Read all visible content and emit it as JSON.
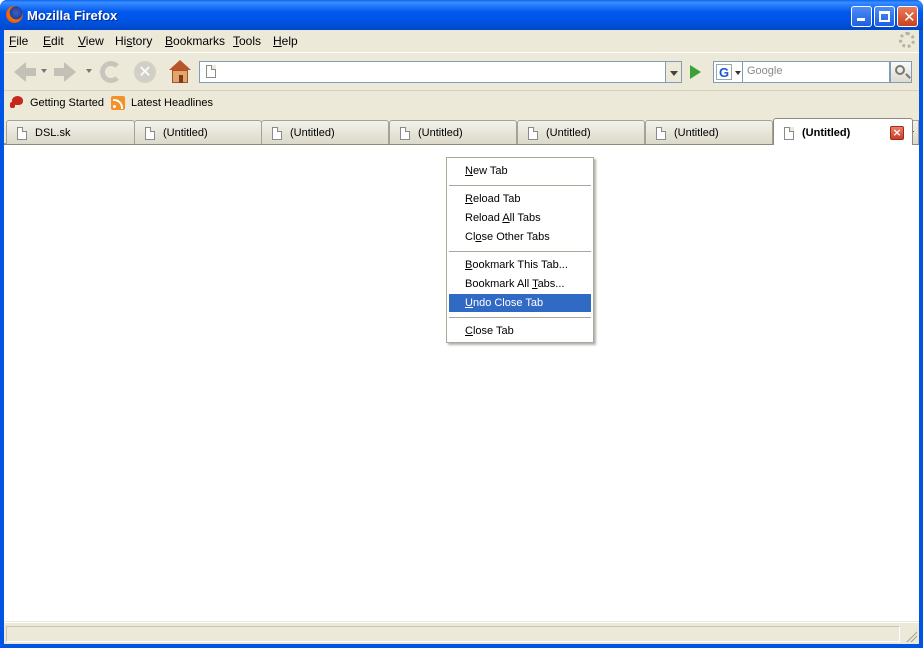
{
  "window": {
    "title": "Mozilla Firefox",
    "colors": {
      "titlebar": "#0054e3",
      "chrome": "#ece9d8",
      "menu_highlight": "#316ac5"
    }
  },
  "menubar": {
    "items": [
      {
        "label": "File",
        "accel": "F",
        "rest": "ile"
      },
      {
        "label": "Edit",
        "accel": "E",
        "rest": "dit"
      },
      {
        "label": "View",
        "accel": "V",
        "rest": "iew"
      },
      {
        "label": "History",
        "accel": "s",
        "pre": "Hi",
        "rest": "tory"
      },
      {
        "label": "Bookmarks",
        "accel": "B",
        "rest": "ookmarks"
      },
      {
        "label": "Tools",
        "accel": "T",
        "rest": "ools"
      },
      {
        "label": "Help",
        "accel": "H",
        "rest": "elp"
      }
    ]
  },
  "navbar": {
    "url_value": "",
    "search_placeholder": "Google",
    "search_engine_letter": "G",
    "stop_glyph": "✕",
    "icons": [
      "back-arrow-icon",
      "forward-arrow-icon",
      "reload-icon",
      "stop-icon",
      "home-icon",
      "go-arrow-icon",
      "magnifier-icon"
    ]
  },
  "bookmarks": {
    "items": [
      {
        "label": "Getting Started",
        "icon": "getting-started-icon"
      },
      {
        "label": "Latest Headlines",
        "icon": "rss-feed-icon"
      }
    ]
  },
  "tabs": [
    {
      "label": "DSL.sk",
      "active": false
    },
    {
      "label": "(Untitled)",
      "active": false
    },
    {
      "label": "(Untitled)",
      "active": false
    },
    {
      "label": "(Untitled)",
      "active": false
    },
    {
      "label": "(Untitled)",
      "active": false
    },
    {
      "label": "(Untitled)",
      "active": false
    },
    {
      "label": "(Untitled)",
      "active": true
    }
  ],
  "tab_close_glyph": "×",
  "context_menu": {
    "items": [
      {
        "label": "New Tab",
        "accel": "N",
        "rest": "ew Tab",
        "highlighted": false
      },
      {
        "separator": true
      },
      {
        "label": "Reload Tab",
        "accel": "R",
        "rest": "eload Tab",
        "highlighted": false
      },
      {
        "label": "Reload All Tabs",
        "pre": "Reload ",
        "accel": "A",
        "rest": "ll Tabs",
        "highlighted": false
      },
      {
        "label": "Close Other Tabs",
        "pre": "Cl",
        "accel": "o",
        "rest": "se Other Tabs",
        "highlighted": false
      },
      {
        "separator": true
      },
      {
        "label": "Bookmark This Tab...",
        "accel": "B",
        "rest": "ookmark This Tab...",
        "highlighted": false
      },
      {
        "label": "Bookmark All Tabs...",
        "pre": "Bookmark All ",
        "accel": "T",
        "rest": "abs...",
        "highlighted": false
      },
      {
        "label": "Undo Close Tab",
        "accel": "U",
        "rest": "ndo Close Tab",
        "highlighted": true
      },
      {
        "separator": true
      },
      {
        "label": "Close Tab",
        "accel": "C",
        "rest": "lose Tab",
        "highlighted": false
      }
    ]
  },
  "status": {
    "text": ""
  }
}
